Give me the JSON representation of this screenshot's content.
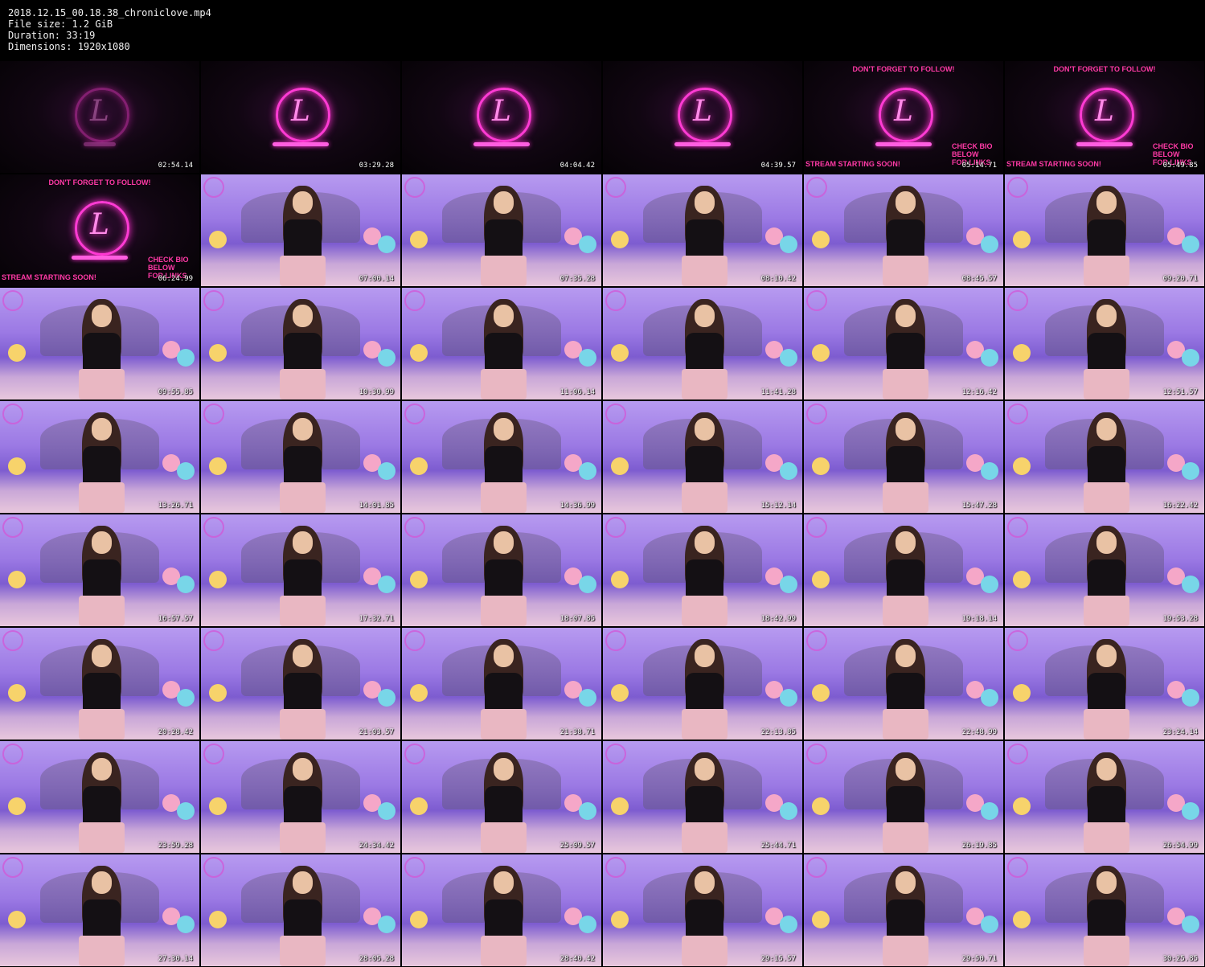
{
  "file_info": {
    "filename": "2018.12.15_00.18.38_chroniclove.mp4",
    "file_size_line": "File size: 1.2 GiB",
    "duration_line": "Duration: 33:19",
    "dimensions_line": "Dimensions: 1920x1080"
  },
  "intro_text": {
    "follow": "DON'T FORGET TO FOLLOW!",
    "soon": "STREAM STARTING SOON!",
    "bio": "CHECK BIO BELOW FOR LINKS"
  },
  "thumbnails": [
    {
      "time": "02:54.14",
      "kind": "intro",
      "variant": "faint"
    },
    {
      "time": "03:29.28",
      "kind": "intro",
      "variant": "plain"
    },
    {
      "time": "04:04.42",
      "kind": "intro",
      "variant": "plain"
    },
    {
      "time": "04:39.57",
      "kind": "intro",
      "variant": "plain"
    },
    {
      "time": "05:14.71",
      "kind": "intro",
      "variant": "banners"
    },
    {
      "time": "05:49.85",
      "kind": "intro",
      "variant": "banners"
    },
    {
      "time": "06:24.99",
      "kind": "intro",
      "variant": "banners"
    },
    {
      "time": "07:00.14",
      "kind": "room"
    },
    {
      "time": "07:35.28",
      "kind": "room"
    },
    {
      "time": "08:10.42",
      "kind": "room"
    },
    {
      "time": "08:45.57",
      "kind": "room"
    },
    {
      "time": "09:20.71",
      "kind": "room"
    },
    {
      "time": "09:55.85",
      "kind": "room"
    },
    {
      "time": "10:30.99",
      "kind": "room"
    },
    {
      "time": "11:06.14",
      "kind": "room"
    },
    {
      "time": "11:41.28",
      "kind": "room"
    },
    {
      "time": "12:16.42",
      "kind": "room"
    },
    {
      "time": "12:51.57",
      "kind": "room"
    },
    {
      "time": "13:26.71",
      "kind": "room"
    },
    {
      "time": "14:01.85",
      "kind": "room"
    },
    {
      "time": "14:36.99",
      "kind": "room"
    },
    {
      "time": "15:12.14",
      "kind": "room"
    },
    {
      "time": "15:47.28",
      "kind": "room"
    },
    {
      "time": "16:22.42",
      "kind": "room"
    },
    {
      "time": "16:57.57",
      "kind": "room"
    },
    {
      "time": "17:32.71",
      "kind": "room"
    },
    {
      "time": "18:07.85",
      "kind": "room"
    },
    {
      "time": "18:42.99",
      "kind": "room"
    },
    {
      "time": "19:18.14",
      "kind": "room"
    },
    {
      "time": "19:53.28",
      "kind": "room"
    },
    {
      "time": "20:28.42",
      "kind": "room"
    },
    {
      "time": "21:03.57",
      "kind": "room"
    },
    {
      "time": "21:38.71",
      "kind": "room"
    },
    {
      "time": "22:13.85",
      "kind": "room"
    },
    {
      "time": "22:48.99",
      "kind": "room"
    },
    {
      "time": "23:24.14",
      "kind": "room"
    },
    {
      "time": "23:59.28",
      "kind": "room"
    },
    {
      "time": "24:34.42",
      "kind": "room"
    },
    {
      "time": "25:09.57",
      "kind": "room"
    },
    {
      "time": "25:44.71",
      "kind": "room"
    },
    {
      "time": "26:19.85",
      "kind": "room"
    },
    {
      "time": "26:54.99",
      "kind": "room"
    },
    {
      "time": "27:30.14",
      "kind": "room"
    },
    {
      "time": "28:05.28",
      "kind": "room"
    },
    {
      "time": "28:40.42",
      "kind": "room"
    },
    {
      "time": "29:15.57",
      "kind": "room"
    },
    {
      "time": "29:50.71",
      "kind": "room"
    },
    {
      "time": "30:25.85",
      "kind": "room"
    }
  ],
  "colors": {
    "background": "#000000",
    "neon_pink": "#ff3bd4",
    "banner_pink": "#ff3aa6",
    "room_purple": "#9b79e4"
  }
}
